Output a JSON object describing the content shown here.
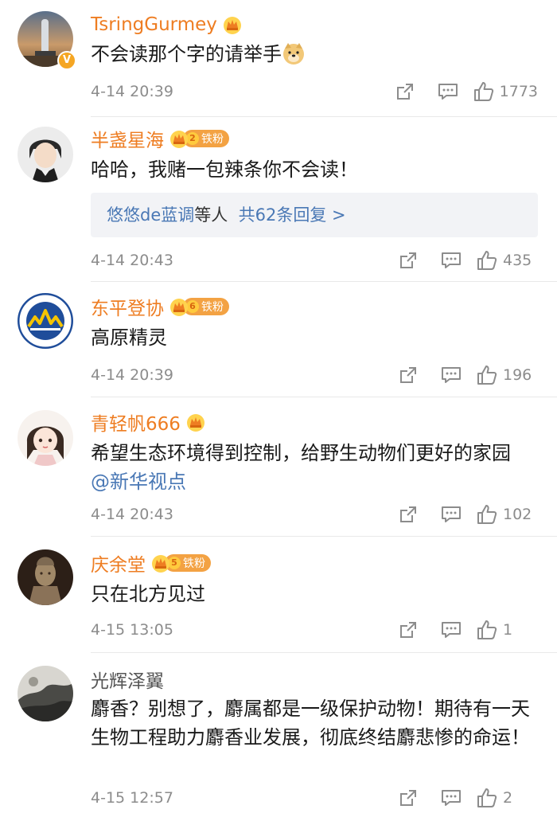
{
  "comments": [
    {
      "username": "TsringGurmey",
      "verified_badge": "V",
      "avatar": "rocket-avatar",
      "fan_badge": null,
      "text": "不会读那个字的请举手",
      "has_doge": true,
      "time": "4-14 20:39",
      "likes": "1773"
    },
    {
      "username": "半盏星海",
      "avatar": "anime-man-avatar",
      "fan_badge": {
        "level": "2",
        "label": "铁粉"
      },
      "text": "哈哈，我赌一包辣条你不会读！",
      "replies": {
        "who": "悠悠de蓝调",
        "mid": "等人",
        "total": "共62条回复 >"
      },
      "time": "4-14 20:43",
      "likes": "435"
    },
    {
      "username": "东平登协",
      "avatar": "mountain-association-logo",
      "fan_badge": {
        "level": "6",
        "label": "铁粉"
      },
      "text": "高原精灵",
      "time": "4-14 20:39",
      "likes": "196"
    },
    {
      "username": "青轻帆666",
      "avatar": "cartoon-girl-avatar",
      "fan_badge": null,
      "text": "希望生态环境得到控制，给野生动物们更好的家园",
      "mention": "@新华视点",
      "time": "4-14 20:43",
      "likes": "102"
    },
    {
      "username": "庆余堂",
      "avatar": "statue-avatar",
      "fan_badge": {
        "level": "5",
        "label": "铁粉"
      },
      "text": "只在北方见过",
      "time": "4-15 13:05",
      "likes": "1"
    },
    {
      "username": "光辉泽翼",
      "avatar": "ink-painting-avatar",
      "fan_badge": null,
      "text": "麝香？别想了，麝属都是一级保护动物！期待有一天生物工程助力麝香业发展，彻底终结麝悲惨的命运！",
      "time": "4-15 12:57",
      "likes": "2"
    }
  ],
  "colors": {
    "username": "#ee7d22",
    "link": "#4a78b5",
    "meta": "#8c8c8c",
    "badge": "#f3a243"
  },
  "icons": [
    "share-icon",
    "reply-icon",
    "like-icon",
    "crown-icon",
    "doge-emoji"
  ]
}
